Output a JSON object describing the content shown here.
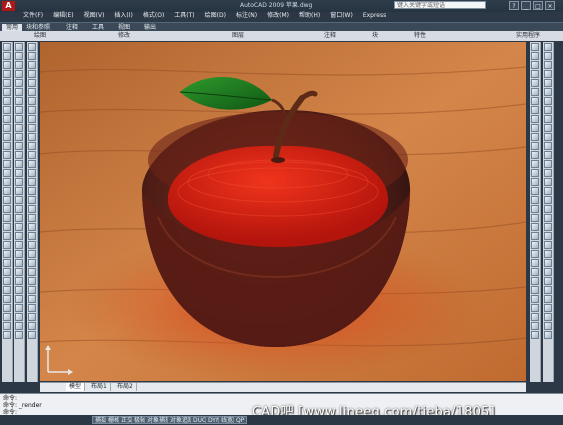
{
  "app": {
    "window_title": "AutoCAD 2009  苹果.dwg",
    "search_placeholder": "键入关键字或短语",
    "window_buttons": [
      "?",
      "_",
      "□",
      "×"
    ]
  },
  "menu": [
    "文件(F)",
    "编辑(E)",
    "视图(V)",
    "插入(I)",
    "格式(O)",
    "工具(T)",
    "绘图(D)",
    "标注(N)",
    "修改(M)",
    "帮助(H)",
    "窗口(W)",
    "Express"
  ],
  "ribbon_tabs": [
    "常用",
    "块和参照",
    "注释",
    "工具",
    "视图",
    "输出"
  ],
  "panels": [
    "绘图",
    "修改",
    "图层",
    "注释",
    "块",
    "特性",
    "实用程序"
  ],
  "layout_tabs": [
    "模型",
    "布局1",
    "布局2"
  ],
  "command_lines": [
    "命令:",
    "命令: _render",
    "命令:"
  ],
  "status_buttons": [
    "捕捉",
    "栅格",
    "正交",
    "极轴",
    "对象捕捉",
    "对象追踪",
    "DUCS",
    "DYN",
    "线宽",
    "QP"
  ],
  "watermark": "CAD吧  [www.lineeg.com/tieba/1805]",
  "colors": {
    "title_bg": "#263340",
    "logo_red": "#b01818",
    "viewport_wood": "#c9743e",
    "apple_red": "#d62414",
    "leaf_green": "#1f7a22"
  }
}
